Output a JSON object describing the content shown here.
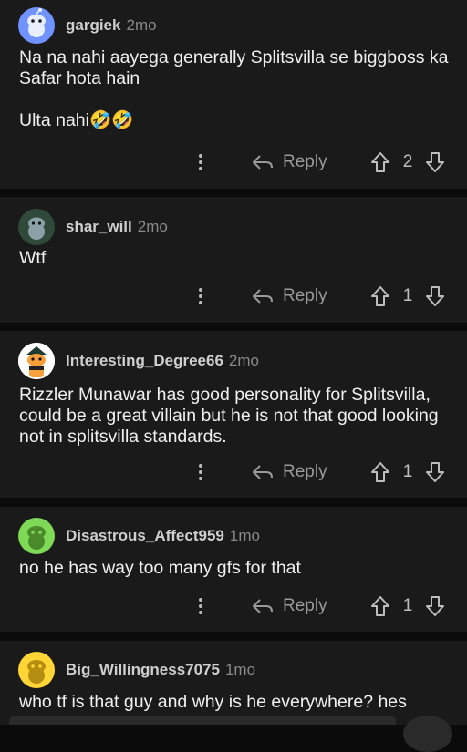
{
  "comments": [
    {
      "username": "gargiek",
      "time": "2mo",
      "body": "Na na nahi aayega generally Splitsvilla se biggboss ka Safar hota hain\n\nUlta nahi🤣🤣",
      "reply_label": "Reply",
      "votes": "2",
      "avatar_color": "#7193ff"
    },
    {
      "username": "shar_will",
      "time": "2mo",
      "body": "Wtf",
      "reply_label": "Reply",
      "votes": "1",
      "avatar_color": "#2f4a3a"
    },
    {
      "username": "Interesting_Degree66",
      "time": "2mo",
      "body": "Rizzler Munawar has good personality for Splitsvilla, could be a great villain but he is not that good looking not in splitsvilla standards.",
      "reply_label": "Reply",
      "votes": "1",
      "avatar_color": "#ffffff"
    },
    {
      "username": "Disastrous_Affect959",
      "time": "1mo",
      "body": "no he has way too many gfs for that",
      "reply_label": "Reply",
      "votes": "1",
      "avatar_color": "#7ed957"
    },
    {
      "username": "Big_Willingness7075",
      "time": "1mo",
      "body": "who tf is that guy and why is he everywhere? hes",
      "reply_label": "",
      "votes": "",
      "avatar_color": "#ffd635"
    }
  ]
}
